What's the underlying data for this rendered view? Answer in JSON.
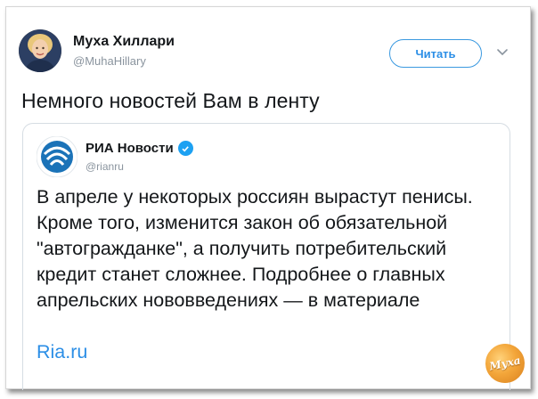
{
  "tweet": {
    "author_name": "Муха Хиллари",
    "author_handle": "@MuhaHillary",
    "follow_label": "Читать",
    "text": "Немного новостей Вам в ленту"
  },
  "quoted": {
    "name": "РИА Новости",
    "handle": "@rianru",
    "text": "В апреле у некоторых россиян вырастут пенисы. Кроме того, изменится закон об обязательной \"автогражданке\", а получить потребительский кредит станет сложнее. Подробнее о главных апрельских нововведениях — в материале",
    "link": "Ria.ru"
  },
  "watermark": {
    "label": "Муха"
  },
  "colors": {
    "link_blue": "#2b8ee6",
    "verified_blue": "#1da1f2",
    "text_dark": "#14171a",
    "text_muted": "#8a949e"
  },
  "icons": {
    "caret": "chevron-down-icon",
    "verified": "verified-badge-icon",
    "ria_logo": "ria-novosti-logo"
  }
}
